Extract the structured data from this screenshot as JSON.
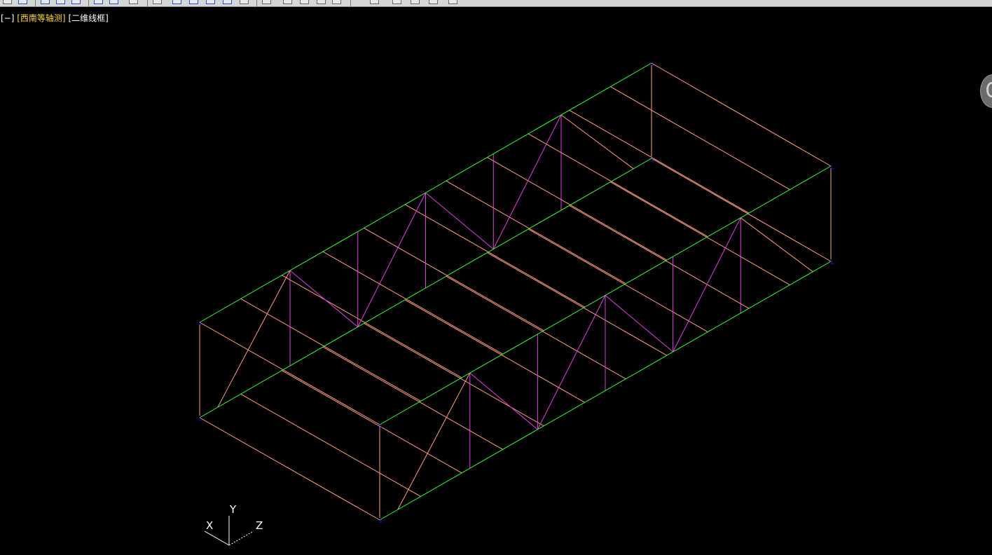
{
  "viewport": {
    "label": {
      "viewport_control": "[−]",
      "view_name": "[西南等轴测]",
      "visual_style": "[二维线框]"
    }
  },
  "ucs_icon": {
    "x_label": "X",
    "y_label": "Y",
    "z_label": "Z"
  },
  "colors": {
    "background": "#000000",
    "chord": "#33ff33",
    "beam": "#ff9f80",
    "diagonal": "#e040e0",
    "support": "#1a1aff",
    "view_label": "#ffd83a"
  }
}
